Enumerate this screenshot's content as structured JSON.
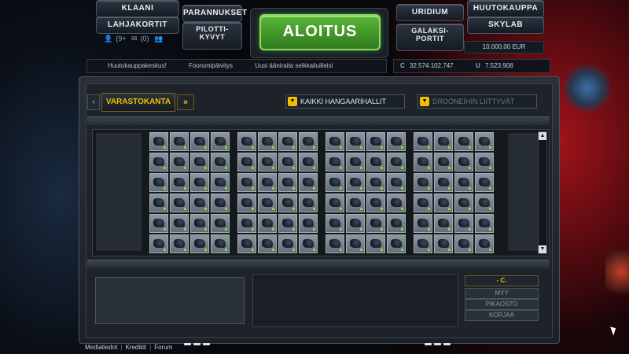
{
  "nav": {
    "klaani": "KLAANI",
    "parannukset": "PARANNUKSET",
    "lahjakortit": "LAHJAKORTIT",
    "pilottikyvyt_line1": "PILOTTI-",
    "pilottikyvyt_line2": "KYVYT",
    "aloitus": "ALOITUS",
    "uridium": "URIDIUM",
    "huutokauppa": "HUUTOKAUPPA",
    "galaksiportit_line1": "GALAKSI-",
    "galaksiportit_line2": "PORTIT",
    "skylab": "SKYLAB",
    "eur": "10.000,00 EUR"
  },
  "status": {
    "users": "(9+",
    "messages": "(0)"
  },
  "ticker": {
    "item1": "Huutokauppakeskus!",
    "item2": "Foorumipäivitys",
    "item3": "Uusi ääniraita seikkailuilleisi"
  },
  "currency": {
    "credits_symbol": "C",
    "credits": "32.574.102.747",
    "uridium_symbol": "U",
    "uridium": "7.523.908"
  },
  "tabs": {
    "prev": "‹",
    "active": "VARASTOKANTA",
    "next": "»",
    "hangar_filter": "KAIKKI HANGAARIHALLIT",
    "drone_filter": "DROONEIHIN LIITTYVÄT"
  },
  "grid": {
    "groups": 4,
    "rows": 6,
    "cols": 4
  },
  "controls": {
    "price": "- C.",
    "sell": "MYY",
    "quick_buy": "PIKAOSTO",
    "repair": "KORJAA"
  },
  "footer": {
    "media": "Mediatiedot",
    "credits": "Krediitit",
    "forum": "Forum",
    "divider": "|"
  },
  "colors": {
    "accent_gold": "#f0c000",
    "start_green": "#5cb83a"
  }
}
